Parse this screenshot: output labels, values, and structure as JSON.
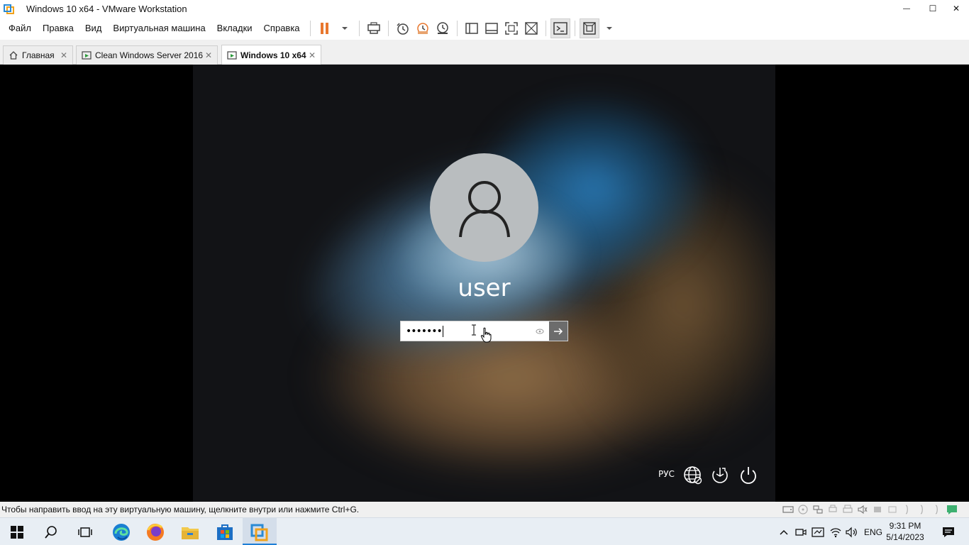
{
  "window": {
    "title": "Windows 10 x64 - VMware Workstation",
    "controls": {
      "minimize": "—",
      "maximize": "☐",
      "close": "✕"
    }
  },
  "menu": {
    "items": [
      "Файл",
      "Правка",
      "Вид",
      "Виртуальная машина",
      "Вкладки",
      "Справка"
    ]
  },
  "toolbar": {
    "icons": [
      "pause-icon",
      "dropdown-arrow-icon",
      "send-ctrl-alt-del-icon",
      "snapshot-icon",
      "revert-snapshot-icon",
      "snapshot-manager-icon",
      "library-icon",
      "thumbnail-bar-icon",
      "full-screen-icon",
      "unity-icon",
      "console-view-icon",
      "stretch-guest-icon",
      "dropdown-arrow-icon"
    ]
  },
  "tabs": [
    {
      "label": "Главная",
      "icon": "home-icon",
      "active": false
    },
    {
      "label": "Clean Windows Server 2016",
      "icon": "vm-running-icon",
      "active": false
    },
    {
      "label": "Windows 10 x64",
      "icon": "vm-running-icon",
      "active": true
    }
  ],
  "guest": {
    "username": "user",
    "password_value": "•••••••",
    "language_indicator": "РУС",
    "icons": [
      "network-icon",
      "ease-of-access-icon",
      "power-icon"
    ]
  },
  "status": {
    "text": "Чтобы направить ввод на эту виртуальную машину, щелкните внутри или нажмите Ctrl+G."
  },
  "taskbar": {
    "apps": [
      "windows-start-icon",
      "search-icon",
      "task-view-icon",
      "edge-icon",
      "firefox-icon",
      "file-explorer-icon",
      "store-icon",
      "vmware-icon"
    ],
    "language": "ENG",
    "time": "9:31 PM",
    "date": "5/14/2023"
  },
  "colors": {
    "accent_orange": "#e8772e",
    "taskbar_active": "#1f7fd6",
    "vmware_blue": "#2a8ad4"
  }
}
